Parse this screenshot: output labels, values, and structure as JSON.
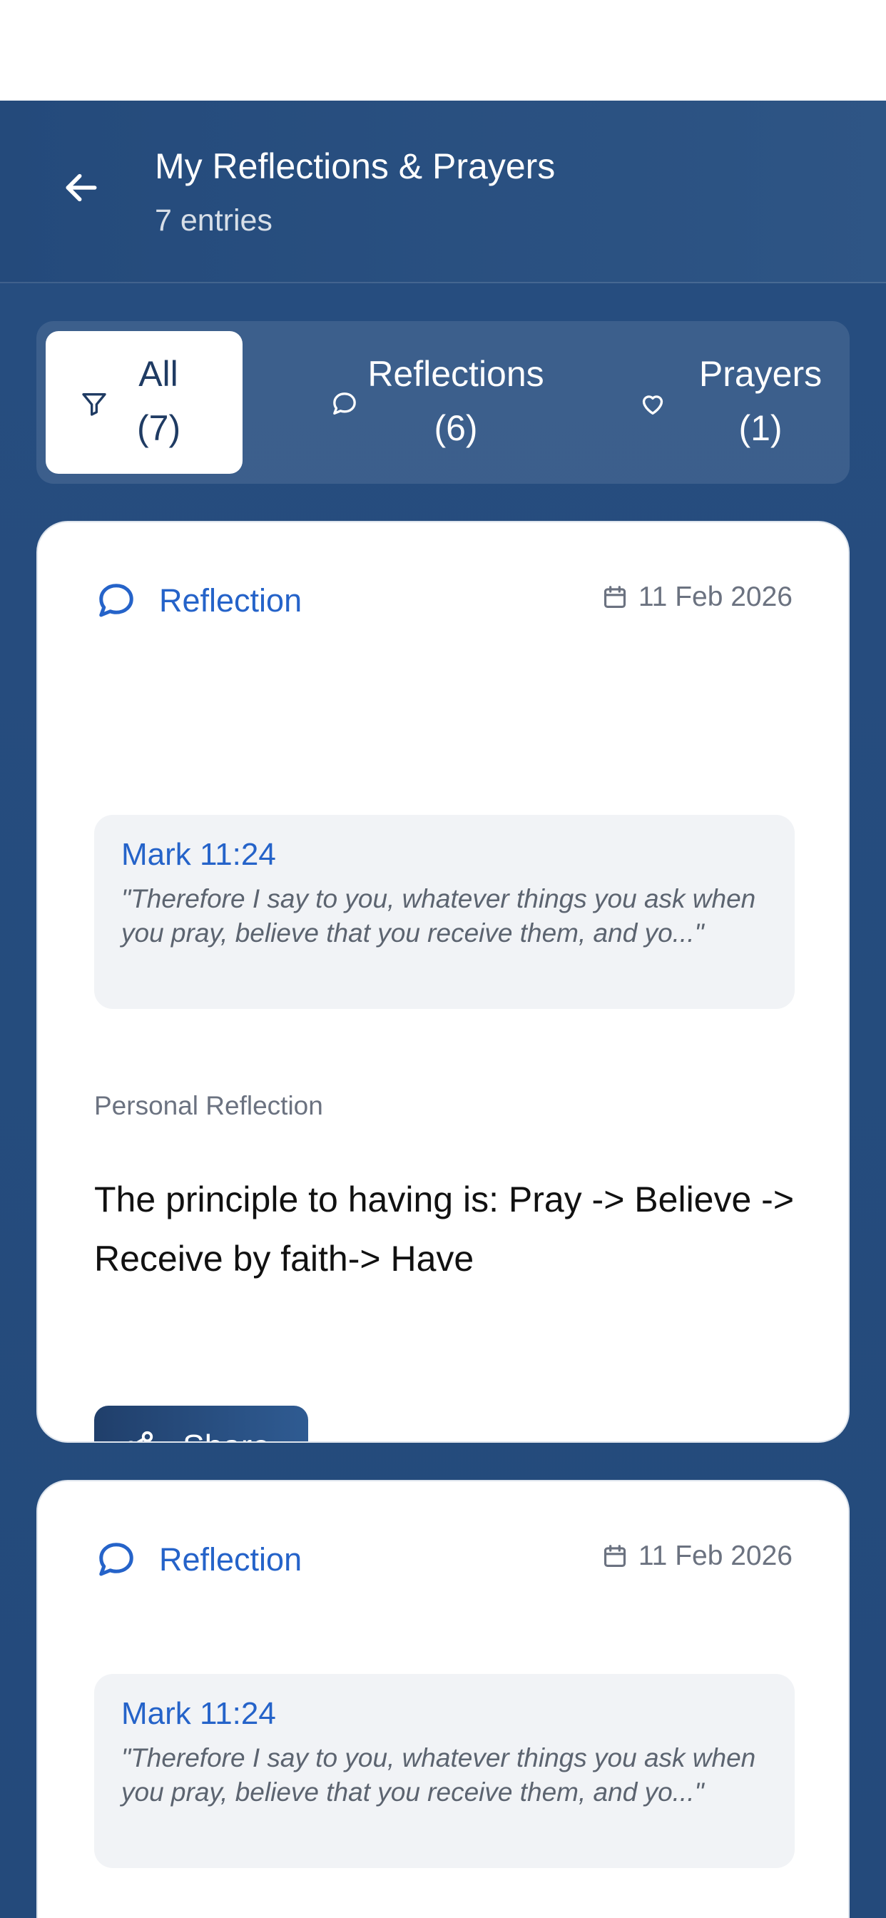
{
  "header": {
    "title": "My Reflections & Prayers",
    "subtitle": "7 entries"
  },
  "filters": [
    {
      "label": "All (7)",
      "icon": "filter-icon",
      "selected": true
    },
    {
      "label": "Reflections (6)",
      "icon": "chat-bubble-icon",
      "selected": false
    },
    {
      "label": "Prayers (1)",
      "icon": "heart-icon",
      "selected": false
    }
  ],
  "entries": [
    {
      "type": "Reflection",
      "date": "11 Feb 2026",
      "verse_ref": "Mark 11:24",
      "verse_text": "\"Therefore I say to you, whatever things you ask when you pray, believe that you receive them, and yo...\"",
      "section_label": "Personal Reflection",
      "body": "The principle to having is: Pray -> Believe -> Receive by faith-> Have",
      "share_label": "Share"
    },
    {
      "type": "Reflection",
      "date": "11 Feb 2026",
      "verse_ref": "Mark 11:24",
      "verse_text": "\"Therefore I say to you, whatever things you ask when you pray, believe that you receive them, and yo...\""
    }
  ],
  "colors": {
    "primary": "#244a7b",
    "accent_blue": "#2563c9",
    "card_bg": "#ffffff",
    "verse_bg": "#f1f3f6"
  }
}
